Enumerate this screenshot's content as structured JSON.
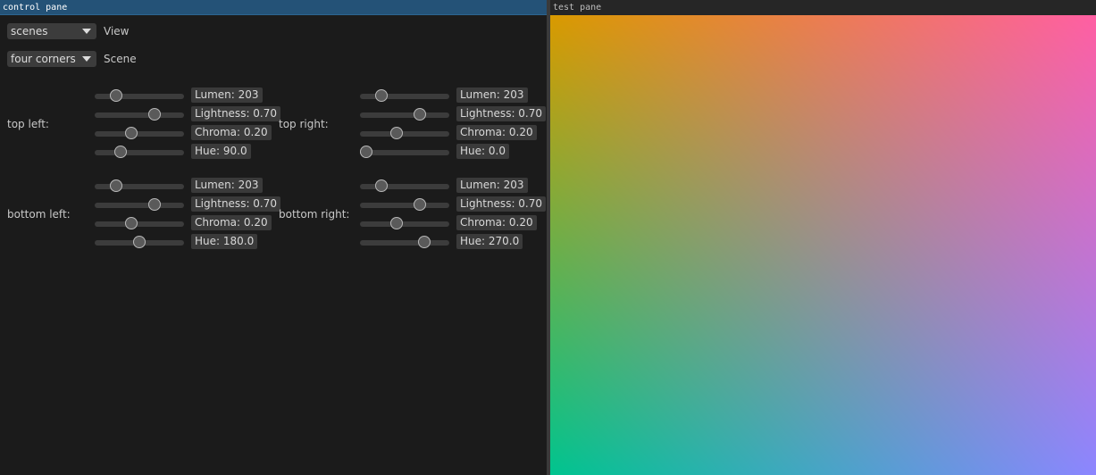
{
  "panes": {
    "control_title": "control pane",
    "test_title": "test pane"
  },
  "view_combo": {
    "value": "scenes",
    "label": "View"
  },
  "scene_combo": {
    "value": "four corners",
    "label": "Scene"
  },
  "groups": [
    {
      "label": "top left:",
      "sliders": [
        {
          "text": "Lumen: 203",
          "fraction": 0.24
        },
        {
          "text": "Lightness: 0.70",
          "fraction": 0.67
        },
        {
          "text": "Chroma: 0.20",
          "fraction": 0.41
        },
        {
          "text": "Hue: 90.0",
          "fraction": 0.29
        }
      ]
    },
    {
      "label": "top right:",
      "sliders": [
        {
          "text": "Lumen: 203",
          "fraction": 0.24
        },
        {
          "text": "Lightness: 0.70",
          "fraction": 0.67
        },
        {
          "text": "Chroma: 0.20",
          "fraction": 0.41
        },
        {
          "text": "Hue: 0.0",
          "fraction": 0.07
        }
      ]
    },
    {
      "label": "bottom left:",
      "sliders": [
        {
          "text": "Lumen: 203",
          "fraction": 0.24
        },
        {
          "text": "Lightness: 0.70",
          "fraction": 0.67
        },
        {
          "text": "Chroma: 0.20",
          "fraction": 0.41
        },
        {
          "text": "Hue: 180.0",
          "fraction": 0.5
        }
      ]
    },
    {
      "label": "bottom right:",
      "sliders": [
        {
          "text": "Lumen: 203",
          "fraction": 0.24
        },
        {
          "text": "Lightness: 0.70",
          "fraction": 0.67
        },
        {
          "text": "Chroma: 0.20",
          "fraction": 0.41
        },
        {
          "text": "Hue: 270.0",
          "fraction": 0.72
        }
      ]
    }
  ],
  "corner_colors": {
    "top_left": "#d99a00",
    "top_right": "#ff5fa3",
    "bottom_left": "#00c48f",
    "bottom_right": "#8c86ff"
  },
  "colors": {
    "accent": "#245277",
    "background": "#1b1b1b",
    "control": "#3c3c3c"
  }
}
